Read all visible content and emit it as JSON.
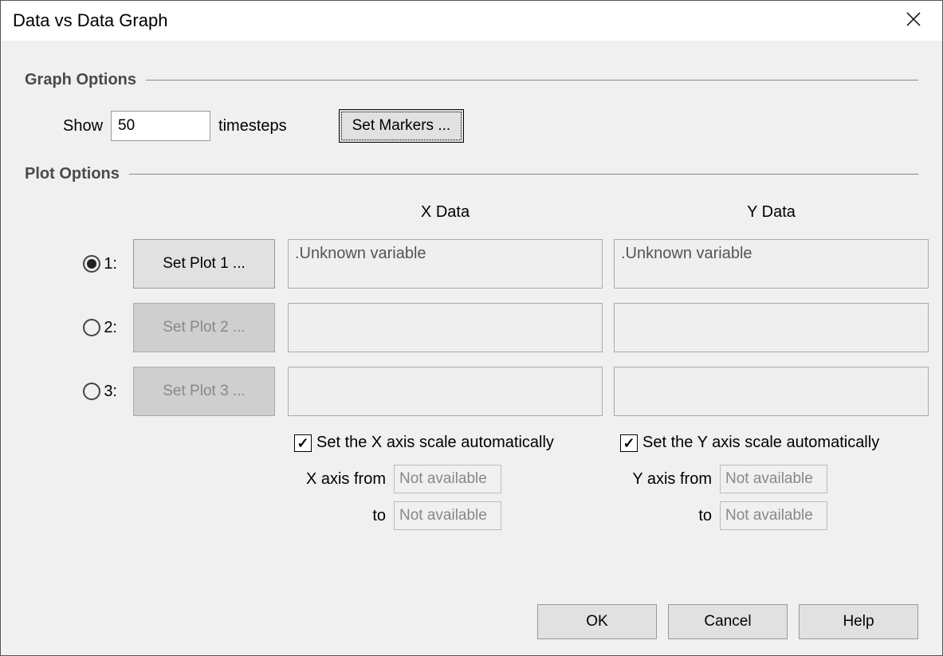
{
  "title": "Data vs Data Graph",
  "sections": {
    "graph": "Graph Options",
    "plot": "Plot Options"
  },
  "graph_options": {
    "show_label": "Show",
    "timesteps_value": "50",
    "timesteps_label": "timesteps",
    "set_markers_label": "Set Markers ..."
  },
  "columns": {
    "x": "X Data",
    "y": "Y Data"
  },
  "plots": [
    {
      "idx": "1:",
      "label": "Set Plot 1 ...",
      "selected": true,
      "enabled": true,
      "x": ".Unknown variable",
      "y": ".Unknown variable"
    },
    {
      "idx": "2:",
      "label": "Set Plot 2 ...",
      "selected": false,
      "enabled": false,
      "x": "",
      "y": ""
    },
    {
      "idx": "3:",
      "label": "Set Plot 3 ...",
      "selected": false,
      "enabled": false,
      "x": "",
      "y": ""
    }
  ],
  "axes": {
    "x_auto_label": "Set the X axis scale automatically",
    "y_auto_label": "Set the Y axis scale automatically",
    "x_auto_checked": true,
    "y_auto_checked": true,
    "x_from_label": "X axis from",
    "y_from_label": "Y axis from",
    "to_label": "to",
    "na": "Not available"
  },
  "buttons": {
    "ok": "OK",
    "cancel": "Cancel",
    "help": "Help"
  }
}
